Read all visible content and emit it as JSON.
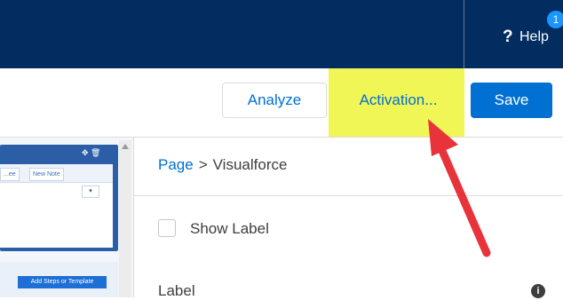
{
  "header": {
    "help_glyph": "?",
    "help_label": "Help",
    "notification_count": "1"
  },
  "toolbar": {
    "analyze_label": "Analyze",
    "activation_label": "Activation...",
    "save_label": "Save"
  },
  "canvas": {
    "card_buttons": [
      "...ee",
      "New Note"
    ],
    "card_dropdown_glyph": "▾",
    "card_tool_glyphs": "✥ 🗑",
    "bottom_button_label": "Add Steps or Template"
  },
  "properties": {
    "breadcrumb_root": "Page",
    "breadcrumb_separator": ">",
    "breadcrumb_current": "Visualforce",
    "show_label_text": "Show Label",
    "field_label": "Label",
    "info_glyph": "i"
  },
  "colors": {
    "header_bg": "#032d60",
    "brand_blue": "#0070d2",
    "highlight": "#eef53a",
    "annotation_arrow": "#e8333a"
  }
}
